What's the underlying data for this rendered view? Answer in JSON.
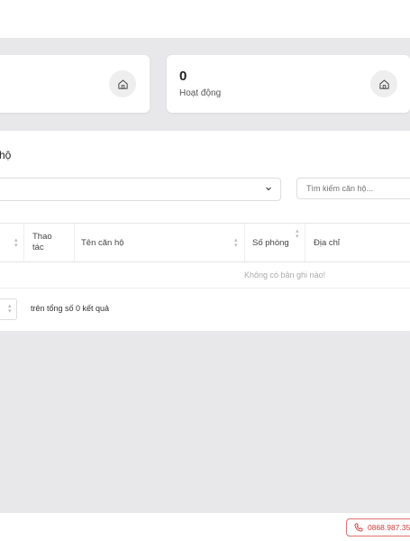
{
  "stats": [
    {
      "value": "",
      "label": ""
    },
    {
      "value": "0",
      "label": "Hoạt động"
    }
  ],
  "panel": {
    "title": "hộ",
    "select_value": "",
    "search_placeholder": "Tìm kiếm căn hộ..."
  },
  "table": {
    "columns": [
      "Thao tác",
      "Tên căn hộ",
      "Số phòng",
      "Địa chỉ"
    ],
    "empty_text": "Không có bản ghi nào!"
  },
  "pagination": {
    "summary": "trên tổng số 0 kết quả"
  },
  "contact": {
    "phone": "0868.987.35"
  },
  "icons": {
    "stat": "home-icon",
    "dropdown": "chevron-down-icon",
    "sort": "sort-icon",
    "phone": "phone-icon"
  },
  "colors": {
    "accent": "#d23c3c",
    "background": "#e8e8ea"
  }
}
